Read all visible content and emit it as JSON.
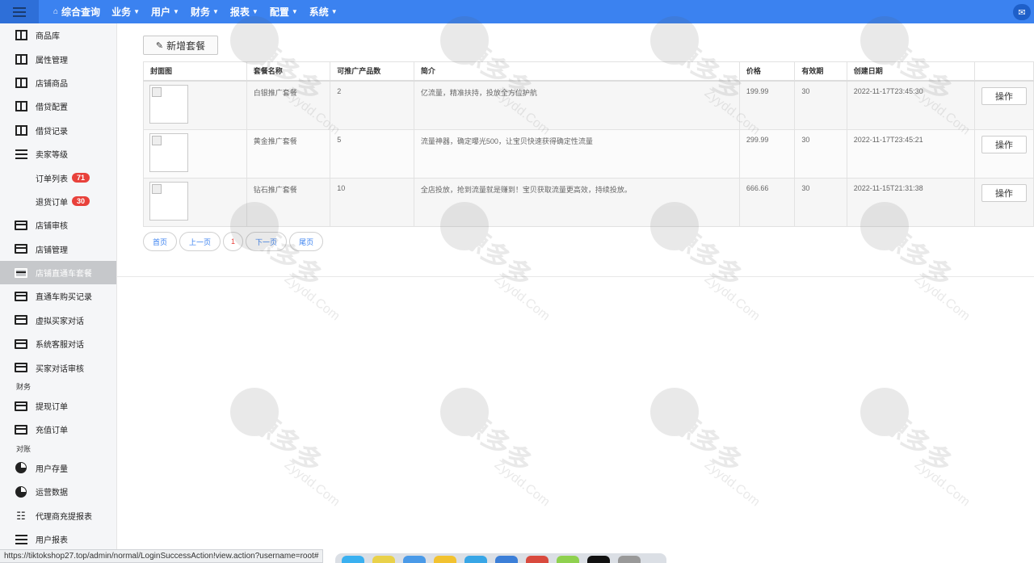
{
  "topbar": {
    "nav": [
      {
        "label": "综合查询",
        "home": true
      },
      {
        "label": "业务"
      },
      {
        "label": "用户"
      },
      {
        "label": "财务"
      },
      {
        "label": "报表"
      },
      {
        "label": "配置"
      },
      {
        "label": "系统"
      }
    ]
  },
  "sidebar": {
    "items": [
      {
        "label": "商品库",
        "icon": "book"
      },
      {
        "label": "属性管理",
        "icon": "book"
      },
      {
        "label": "店铺商品",
        "icon": "book"
      },
      {
        "label": "借贷配置",
        "icon": "book"
      },
      {
        "label": "借贷记录",
        "icon": "book"
      },
      {
        "label": "卖家等级",
        "icon": "list"
      },
      {
        "label": "订单列表",
        "badge": "71",
        "sub": true
      },
      {
        "label": "退货订单",
        "badge": "30",
        "sub": true
      },
      {
        "label": "店铺审核",
        "icon": "card"
      },
      {
        "label": "店铺管理",
        "icon": "card"
      },
      {
        "label": "店铺直通车套餐",
        "icon": "card",
        "active": true
      },
      {
        "label": "直通车购买记录",
        "icon": "card"
      },
      {
        "label": "虚拟买家对话",
        "icon": "card"
      },
      {
        "label": "系统客服对话",
        "icon": "card"
      },
      {
        "label": "买家对话审核",
        "icon": "card"
      }
    ],
    "group_finance": "财务",
    "finance_items": [
      {
        "label": "提现订单",
        "icon": "card"
      },
      {
        "label": "充值订单",
        "icon": "card"
      }
    ],
    "group_reconcile": "对账",
    "reconcile_items": [
      {
        "label": "用户存量",
        "icon": "pie"
      },
      {
        "label": "运营数据",
        "icon": "pie"
      },
      {
        "label": "代理商充提报表",
        "icon": "org"
      },
      {
        "label": "用户报表",
        "icon": "list"
      }
    ]
  },
  "main": {
    "add_button": "新增套餐",
    "columns": [
      "封面图",
      "套餐名称",
      "可推广产品数",
      "简介",
      "价格",
      "有效期",
      "创建日期",
      ""
    ],
    "rows": [
      {
        "name": "白银推广套餐",
        "count": "2",
        "desc": "亿流量，精准扶持，投放全方位护航",
        "price": "199.99",
        "validity": "30",
        "created": "2022-11-17T23:45:30",
        "op": "操作"
      },
      {
        "name": "黄金推广套餐",
        "count": "5",
        "desc": "流量神器，确定曝光500，让宝贝快速获得确定性流量",
        "price": "299.99",
        "validity": "30",
        "created": "2022-11-17T23:45:21",
        "op": "操作"
      },
      {
        "name": "钻石推广套餐",
        "count": "10",
        "desc": "全店投放，抢到流量就是赚到！宝贝获取流量更高效，持续投放。",
        "price": "666.66",
        "validity": "30",
        "created": "2022-11-15T21:31:38",
        "op": "操作"
      }
    ],
    "pager": {
      "first": "首页",
      "prev": "上一页",
      "current": "1",
      "next": "下一页",
      "last": "尾页"
    }
  },
  "watermark": {
    "text": "源多多",
    "sub": "Zyydd.Com"
  },
  "status_url": "https://tiktokshop27.top/admin/normal/LoginSuccessAction!view.action?username=root#"
}
